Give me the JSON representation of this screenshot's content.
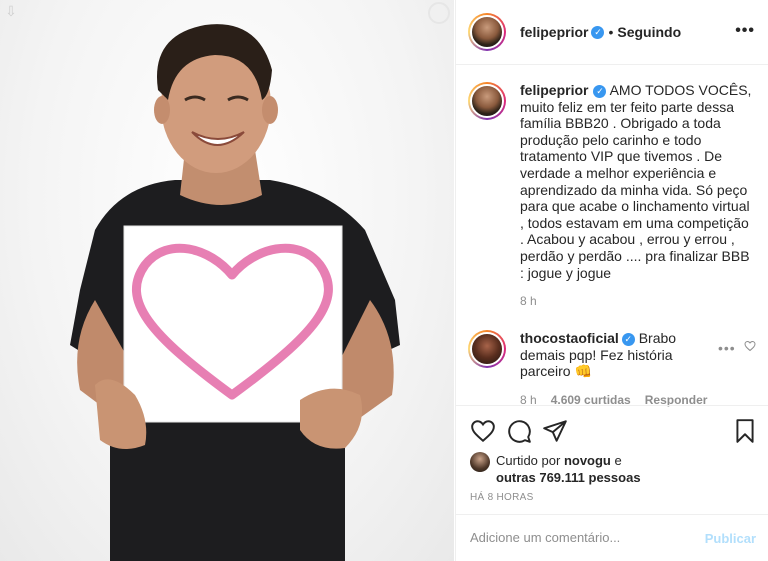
{
  "post": {
    "author": "felipeprior",
    "follow_status": "Seguindo",
    "more_icon": "•••",
    "caption": "AMO TODOS VOCÊS, muito feliz em ter feito parte dessa família BBB20 . Obrigado a toda produção pelo carinho e todo tratamento VIP que tivemos . De verdade a melhor experiência e aprendizado da minha vida. Só peço para que acabe o linchamento virtual , todos estavam em uma competição . Acabou y acabou , errou y errou , perdão y perdão .... pra finalizar BBB : jogue y jogue",
    "caption_time": "8 h"
  },
  "comment": {
    "author": "thocostaoficial",
    "text": "Brabo demais pqp! Fez história parceiro 👊",
    "time": "8 h",
    "likes": "4.609 curtidas",
    "reply": "Responder",
    "more": "•••"
  },
  "likes": {
    "prefix": "Curtido por",
    "user": "novogu",
    "connector": "e",
    "others": "outras 769.111 pessoas"
  },
  "time_ago": "HÁ 8 HORAS",
  "comment_box": {
    "placeholder": "Adicione um comentário...",
    "publish": "Publicar"
  },
  "icons": [
    "heart-icon",
    "comment-icon",
    "share-icon",
    "bookmark-icon",
    "verified-icon",
    "more-icon"
  ],
  "colors": {
    "verified": "#3897f0",
    "publish": "#b2dffc",
    "muted": "#8e8e8e",
    "heart_pink": "#e77fb3"
  }
}
